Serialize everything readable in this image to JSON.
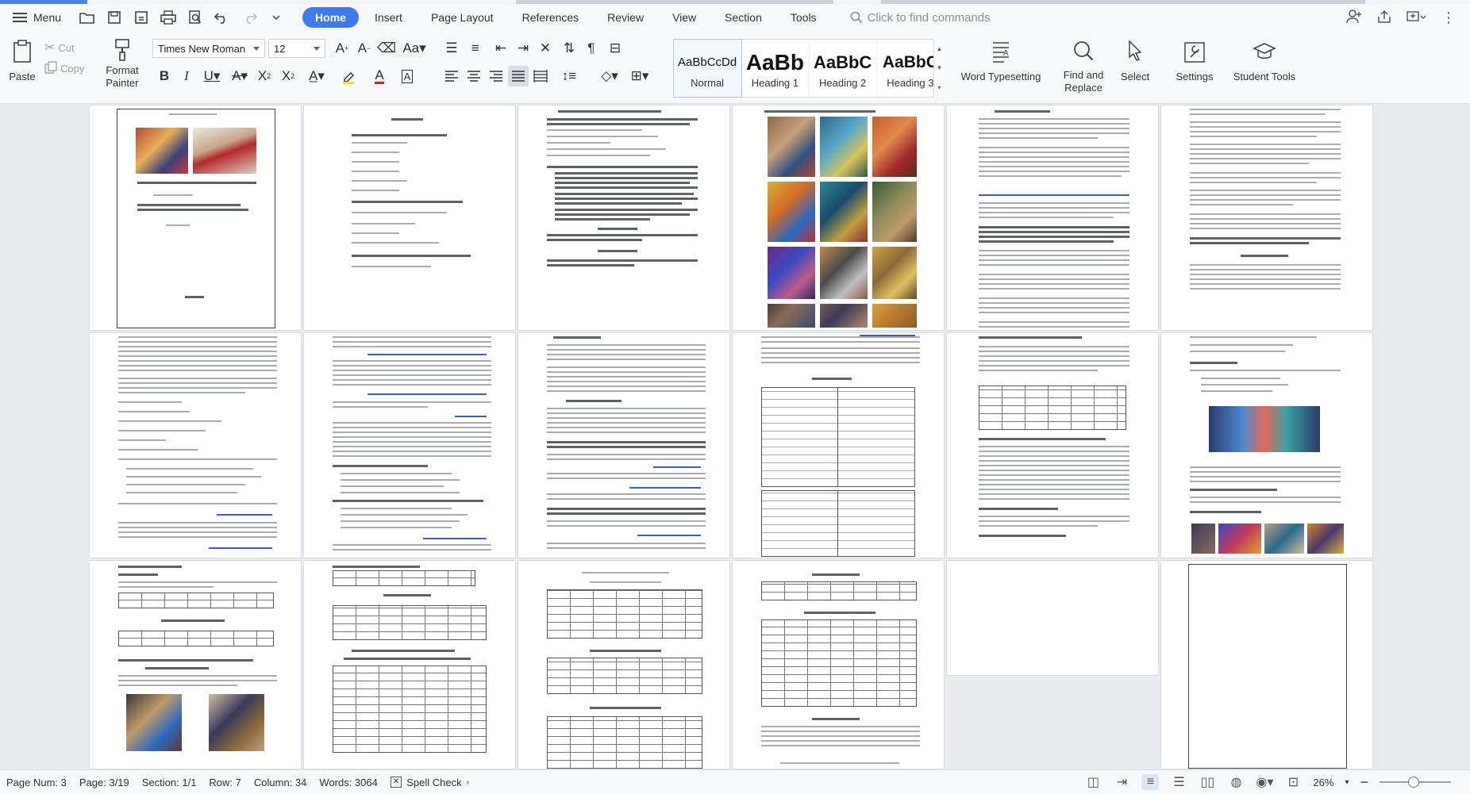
{
  "menubar": {
    "menu_label": "Menu",
    "tabs": [
      {
        "label": "Home",
        "active": true
      },
      {
        "label": "Insert"
      },
      {
        "label": "Page Layout"
      },
      {
        "label": "References"
      },
      {
        "label": "Review"
      },
      {
        "label": "View"
      },
      {
        "label": "Section"
      },
      {
        "label": "Tools"
      }
    ],
    "search_placeholder": "Click to find commands"
  },
  "toolbar": {
    "paste_label": "Paste",
    "cut_label": "Cut",
    "copy_label": "Copy",
    "format_painter_label": "Format Painter",
    "font_name": "Times New Roman",
    "font_size": "12",
    "styles": [
      {
        "sample": "AaBbCcDd",
        "name": "Normal"
      },
      {
        "sample": "AaBb",
        "name": "Heading 1"
      },
      {
        "sample": "AaBbC",
        "name": "Heading 2"
      },
      {
        "sample": "AaBbC",
        "name": "Heading 3"
      }
    ],
    "word_typesetting_label": "Word Typesetting",
    "find_replace_label": "Find and Replace",
    "select_label": "Select",
    "settings_label": "Settings",
    "student_tools_label": "Student Tools"
  },
  "statusbar": {
    "page_num": "Page Num: 3",
    "page": "Page: 3/19",
    "section": "Section: 1/1",
    "row": "Row: 7",
    "column": "Column: 34",
    "words": "Words: 3064",
    "spell_check": "Spell Check",
    "zoom": "26%"
  },
  "colors": {
    "accent": "#3d7cf0",
    "link_blue": "#3a5fc8"
  }
}
